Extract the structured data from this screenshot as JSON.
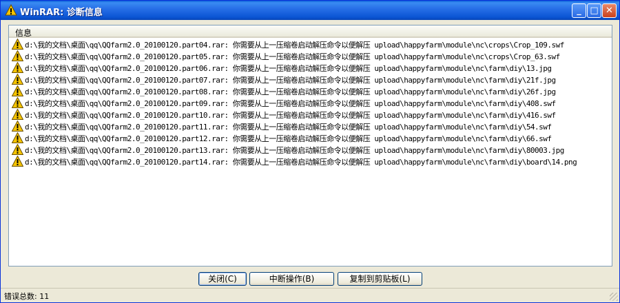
{
  "window": {
    "title": "WinRAR: 诊断信息",
    "min_glyph": "_",
    "max_glyph": "□",
    "close_glyph": "✕"
  },
  "list": {
    "column_header": "信息",
    "rows": [
      "d:\\我的文档\\桌面\\qq\\QQfarm2.0_20100120.part04.rar: 你需要从上一压缩卷启动解压命令以便解压 upload\\happyfarm\\module\\nc\\crops\\Crop_109.swf",
      "d:\\我的文档\\桌面\\qq\\QQfarm2.0_20100120.part05.rar: 你需要从上一压缩卷启动解压命令以便解压 upload\\happyfarm\\module\\nc\\crops\\Crop_63.swf",
      "d:\\我的文档\\桌面\\qq\\QQfarm2.0_20100120.part06.rar: 你需要从上一压缩卷启动解压命令以便解压 upload\\happyfarm\\module\\nc\\farm\\diy\\13.jpg",
      "d:\\我的文档\\桌面\\qq\\QQfarm2.0_20100120.part07.rar: 你需要从上一压缩卷启动解压命令以便解压 upload\\happyfarm\\module\\nc\\farm\\diy\\21f.jpg",
      "d:\\我的文档\\桌面\\qq\\QQfarm2.0_20100120.part08.rar: 你需要从上一压缩卷启动解压命令以便解压 upload\\happyfarm\\module\\nc\\farm\\diy\\26f.jpg",
      "d:\\我的文档\\桌面\\qq\\QQfarm2.0_20100120.part09.rar: 你需要从上一压缩卷启动解压命令以便解压 upload\\happyfarm\\module\\nc\\farm\\diy\\408.swf",
      "d:\\我的文档\\桌面\\qq\\QQfarm2.0_20100120.part10.rar: 你需要从上一压缩卷启动解压命令以便解压 upload\\happyfarm\\module\\nc\\farm\\diy\\416.swf",
      "d:\\我的文档\\桌面\\qq\\QQfarm2.0_20100120.part11.rar: 你需要从上一压缩卷启动解压命令以便解压 upload\\happyfarm\\module\\nc\\farm\\diy\\54.swf",
      "d:\\我的文档\\桌面\\qq\\QQfarm2.0_20100120.part12.rar: 你需要从上一压缩卷启动解压命令以便解压 upload\\happyfarm\\module\\nc\\farm\\diy\\66.swf",
      "d:\\我的文档\\桌面\\qq\\QQfarm2.0_20100120.part13.rar: 你需要从上一压缩卷启动解压命令以便解压 upload\\happyfarm\\module\\nc\\farm\\diy\\80003.jpg",
      "d:\\我的文档\\桌面\\qq\\QQfarm2.0_20100120.part14.rar: 你需要从上一压缩卷启动解压命令以便解压 upload\\happyfarm\\module\\nc\\farm\\diy\\board\\14.png"
    ]
  },
  "buttons": {
    "close": "关闭(C)",
    "abort": "中断操作(B)",
    "copy": "复制到剪贴板(L)"
  },
  "status": {
    "text": "错误总数: 11"
  },
  "icons": {
    "row_icon": "warning-icon",
    "title_icon": "warning-icon"
  },
  "colors": {
    "titlebar": "#0b55d4",
    "warning": "#f5c400"
  }
}
